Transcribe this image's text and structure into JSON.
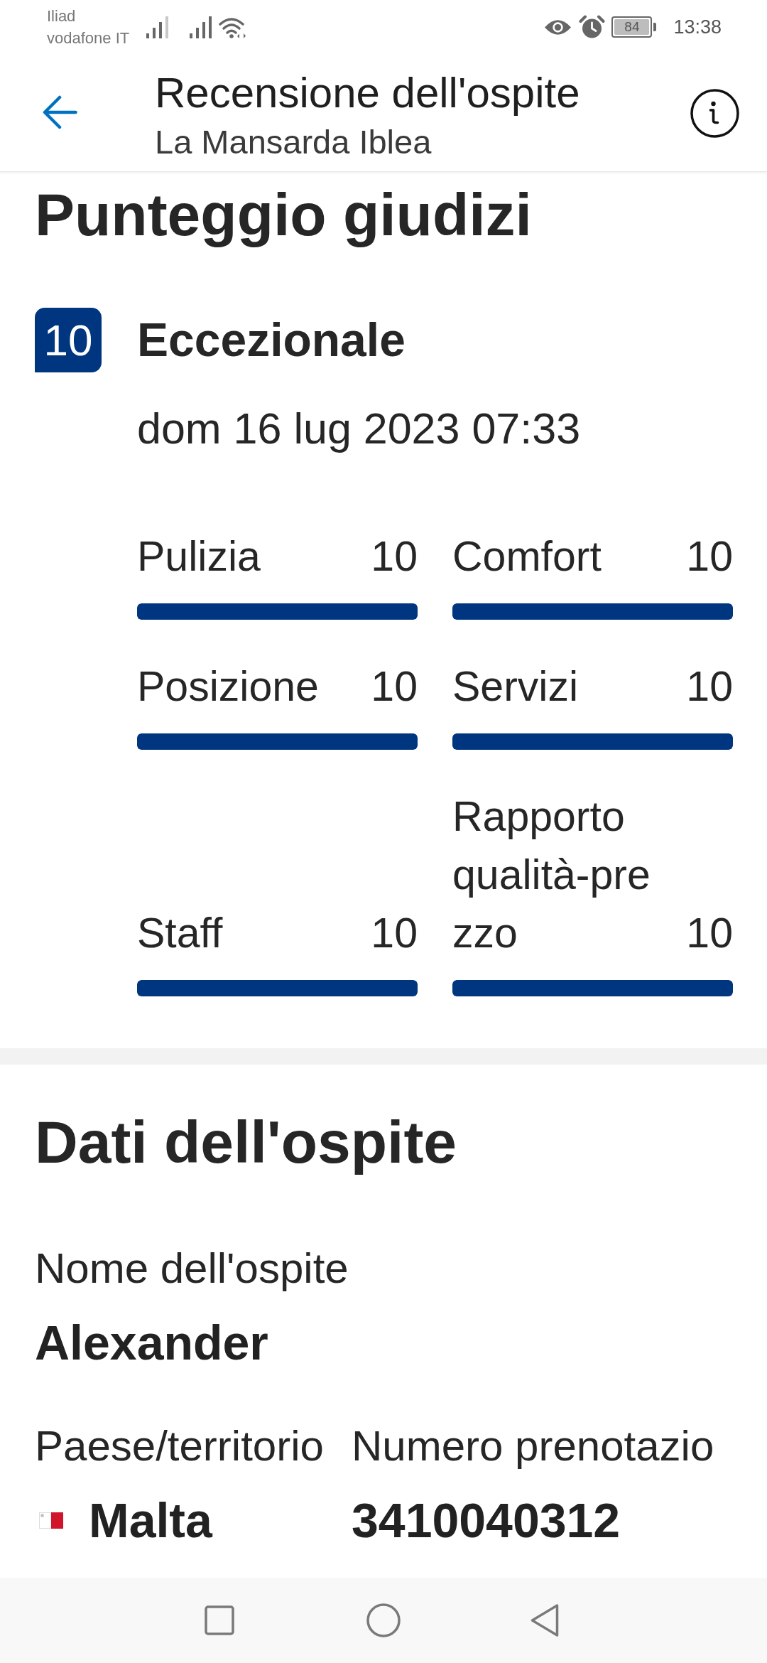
{
  "status_bar": {
    "carriers": [
      "Iliad",
      "vodafone IT"
    ],
    "battery": "84",
    "time": "13:38"
  },
  "header": {
    "title": "Recensione dell'ospite",
    "subtitle": "La Mansarda Iblea"
  },
  "review_scores": {
    "title": "Punteggio giudizi",
    "score": "10",
    "rating": "Eccezionale",
    "date": "dom 16 lug 2023 07:33",
    "categories": [
      {
        "name": "Pulizia",
        "score": "10",
        "level": 1
      },
      {
        "name": "Posizione",
        "score": "10",
        "level": 1
      },
      {
        "name": "Staff",
        "score": "10",
        "level": 1
      },
      {
        "name": "Comfort",
        "score": "10",
        "level": 1
      },
      {
        "name": "Servizi",
        "score": "10",
        "level": 1
      },
      {
        "name": "Rapporto qualità-prezzo",
        "score": "10",
        "level": 1
      }
    ]
  },
  "guest_details": {
    "title": "Dati dell'ospite",
    "rows": [
      {
        "fields": [
          {
            "kind": "text",
            "label": "Nome dell'ospite",
            "value": "Alexander"
          }
        ]
      },
      {
        "fields": [
          {
            "kind": "country",
            "label": "Paese/territorio",
            "value": "Malta"
          },
          {
            "kind": "text",
            "label": "Numero prenotazio",
            "value": "3410040312"
          }
        ]
      }
    ]
  }
}
